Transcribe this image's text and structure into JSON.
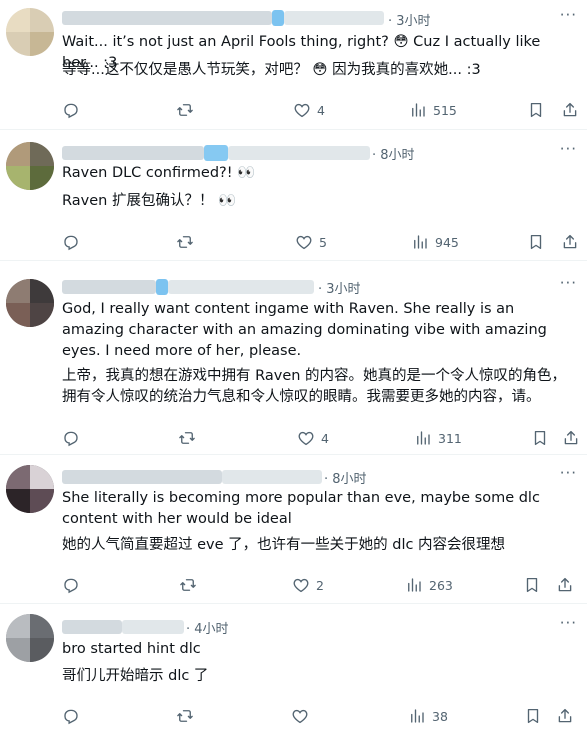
{
  "colors": {
    "text": "#0f1419",
    "muted": "#536471",
    "divider": "#eff3f4",
    "blurred_name": "#cfd9de",
    "blurred_verified": "#7cc3f0"
  },
  "replies": [
    {
      "time": "· 3小时",
      "more": "···",
      "text_en": "Wait... it’s not just an April Fools thing, right? 😳 Cuz I actually like her... :3",
      "text_zh": "等等...这不仅仅是愚人节玩笑，对吧？ 😳 因为我真的喜欢她... :3",
      "likes": "4",
      "views": "515"
    },
    {
      "time": "· 8小时",
      "more": "···",
      "text_en": "Raven DLC confirmed?! 👀",
      "text_zh": "Raven 扩展包确认？！ 👀",
      "likes": "5",
      "views": "945"
    },
    {
      "time": "· 3小时",
      "more": "···",
      "text_en": "God, I really want content ingame with Raven. She really is an amazing character with an amazing dominating vibe with amazing eyes. I need more of her, please.",
      "text_zh": "上帝，我真的想在游戏中拥有 Raven 的内容。她真的是一个令人惊叹的角色，拥有令人惊叹的统治力气息和令人惊叹的眼睛。我需要更多她的内容，请。",
      "likes": "4",
      "views": "311"
    },
    {
      "time": "· 8小时",
      "more": "···",
      "text_en": "She literally is becoming more popular than eve, maybe some dlc content with her would be ideal",
      "text_zh": "她的人气简直要超过 eve 了，也许有一些关于她的 dlc 内容会很理想",
      "likes": "2",
      "views": "263"
    },
    {
      "time": "· 4小时",
      "more": "···",
      "text_en": "bro started hint dlc",
      "text_zh": "哥们儿开始暗示 dlc 了",
      "likes": "",
      "views": "38"
    }
  ]
}
